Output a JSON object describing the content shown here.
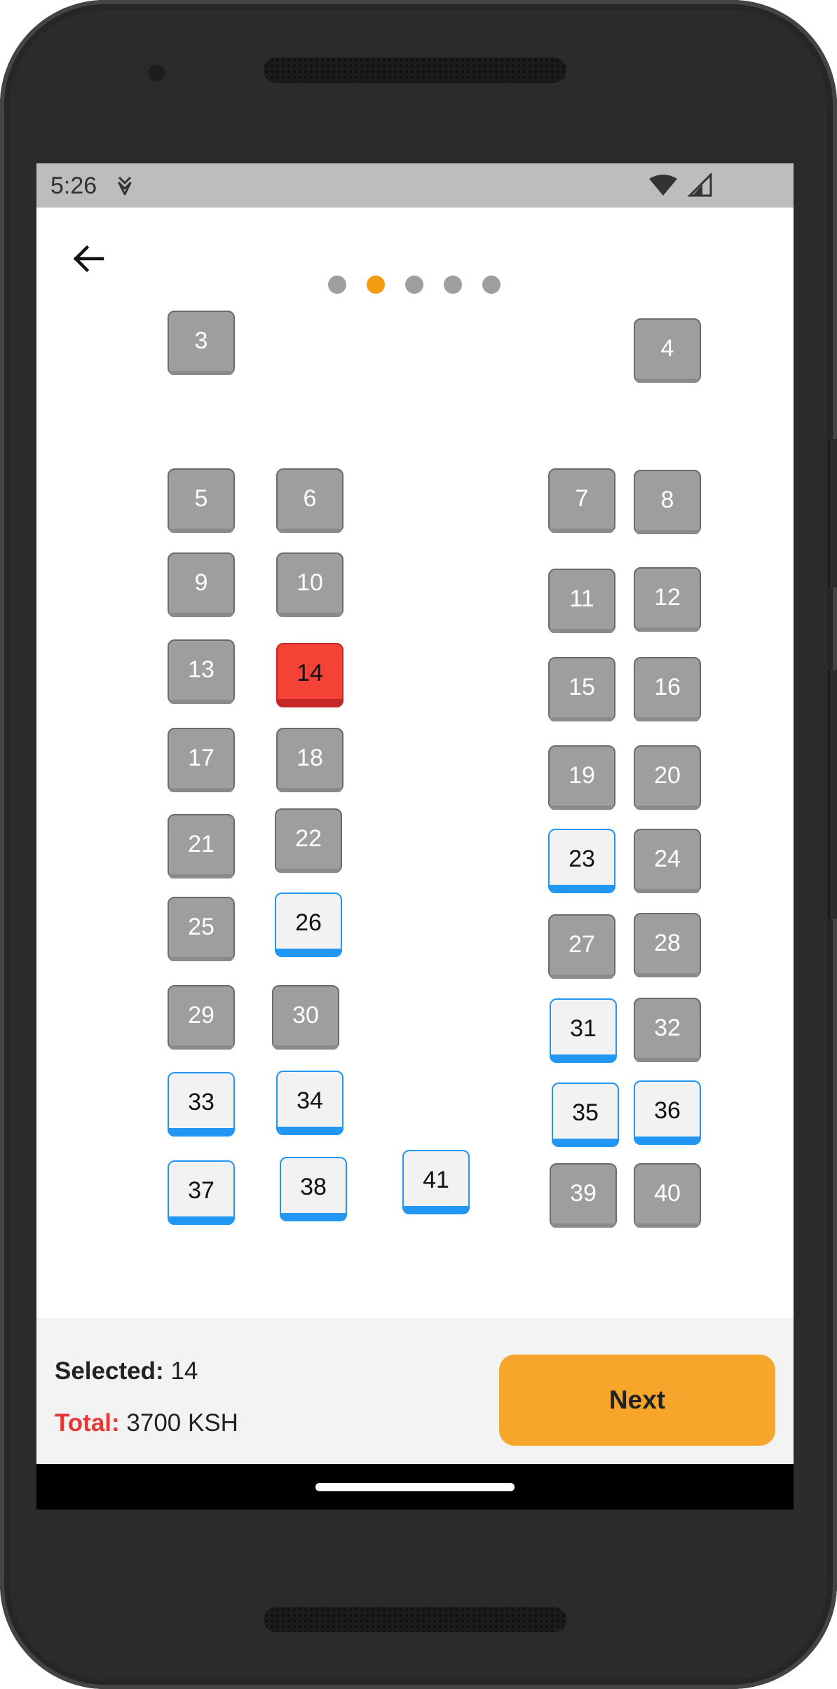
{
  "status": {
    "time": "5:26"
  },
  "header": {
    "back_icon": "arrow-left-icon"
  },
  "pager": {
    "count": 5,
    "active_index": 1,
    "active_color": "#f39c12",
    "inactive_color": "#9e9e9e"
  },
  "seats": [
    {
      "label": "3",
      "state": "booked"
    },
    {
      "label": "4",
      "state": "booked"
    },
    {
      "label": "5",
      "state": "booked"
    },
    {
      "label": "6",
      "state": "booked"
    },
    {
      "label": "7",
      "state": "booked"
    },
    {
      "label": "8",
      "state": "booked"
    },
    {
      "label": "9",
      "state": "booked"
    },
    {
      "label": "10",
      "state": "booked"
    },
    {
      "label": "11",
      "state": "booked"
    },
    {
      "label": "12",
      "state": "booked"
    },
    {
      "label": "13",
      "state": "booked"
    },
    {
      "label": "14",
      "state": "selected"
    },
    {
      "label": "15",
      "state": "booked"
    },
    {
      "label": "16",
      "state": "booked"
    },
    {
      "label": "17",
      "state": "booked"
    },
    {
      "label": "18",
      "state": "booked"
    },
    {
      "label": "19",
      "state": "booked"
    },
    {
      "label": "20",
      "state": "booked"
    },
    {
      "label": "21",
      "state": "booked"
    },
    {
      "label": "22",
      "state": "booked"
    },
    {
      "label": "23",
      "state": "available"
    },
    {
      "label": "24",
      "state": "booked"
    },
    {
      "label": "25",
      "state": "booked"
    },
    {
      "label": "26",
      "state": "available"
    },
    {
      "label": "27",
      "state": "booked"
    },
    {
      "label": "28",
      "state": "booked"
    },
    {
      "label": "29",
      "state": "booked"
    },
    {
      "label": "30",
      "state": "booked"
    },
    {
      "label": "31",
      "state": "available"
    },
    {
      "label": "32",
      "state": "booked"
    },
    {
      "label": "33",
      "state": "available"
    },
    {
      "label": "34",
      "state": "available"
    },
    {
      "label": "35",
      "state": "available"
    },
    {
      "label": "36",
      "state": "available"
    },
    {
      "label": "37",
      "state": "available"
    },
    {
      "label": "38",
      "state": "available"
    },
    {
      "label": "41",
      "state": "available"
    },
    {
      "label": "39",
      "state": "booked"
    },
    {
      "label": "40",
      "state": "booked"
    }
  ],
  "colors": {
    "booked": "#9e9e9e",
    "available_accent": "#2196f3",
    "selected": "#f44336",
    "next_button": "#f6a62b",
    "total_label": "#e53935"
  },
  "summary": {
    "selected_label": "Selected:",
    "selected_value": "14",
    "total_label": "Total:",
    "total_value": "3700 KSH"
  },
  "actions": {
    "next_label": "Next"
  }
}
